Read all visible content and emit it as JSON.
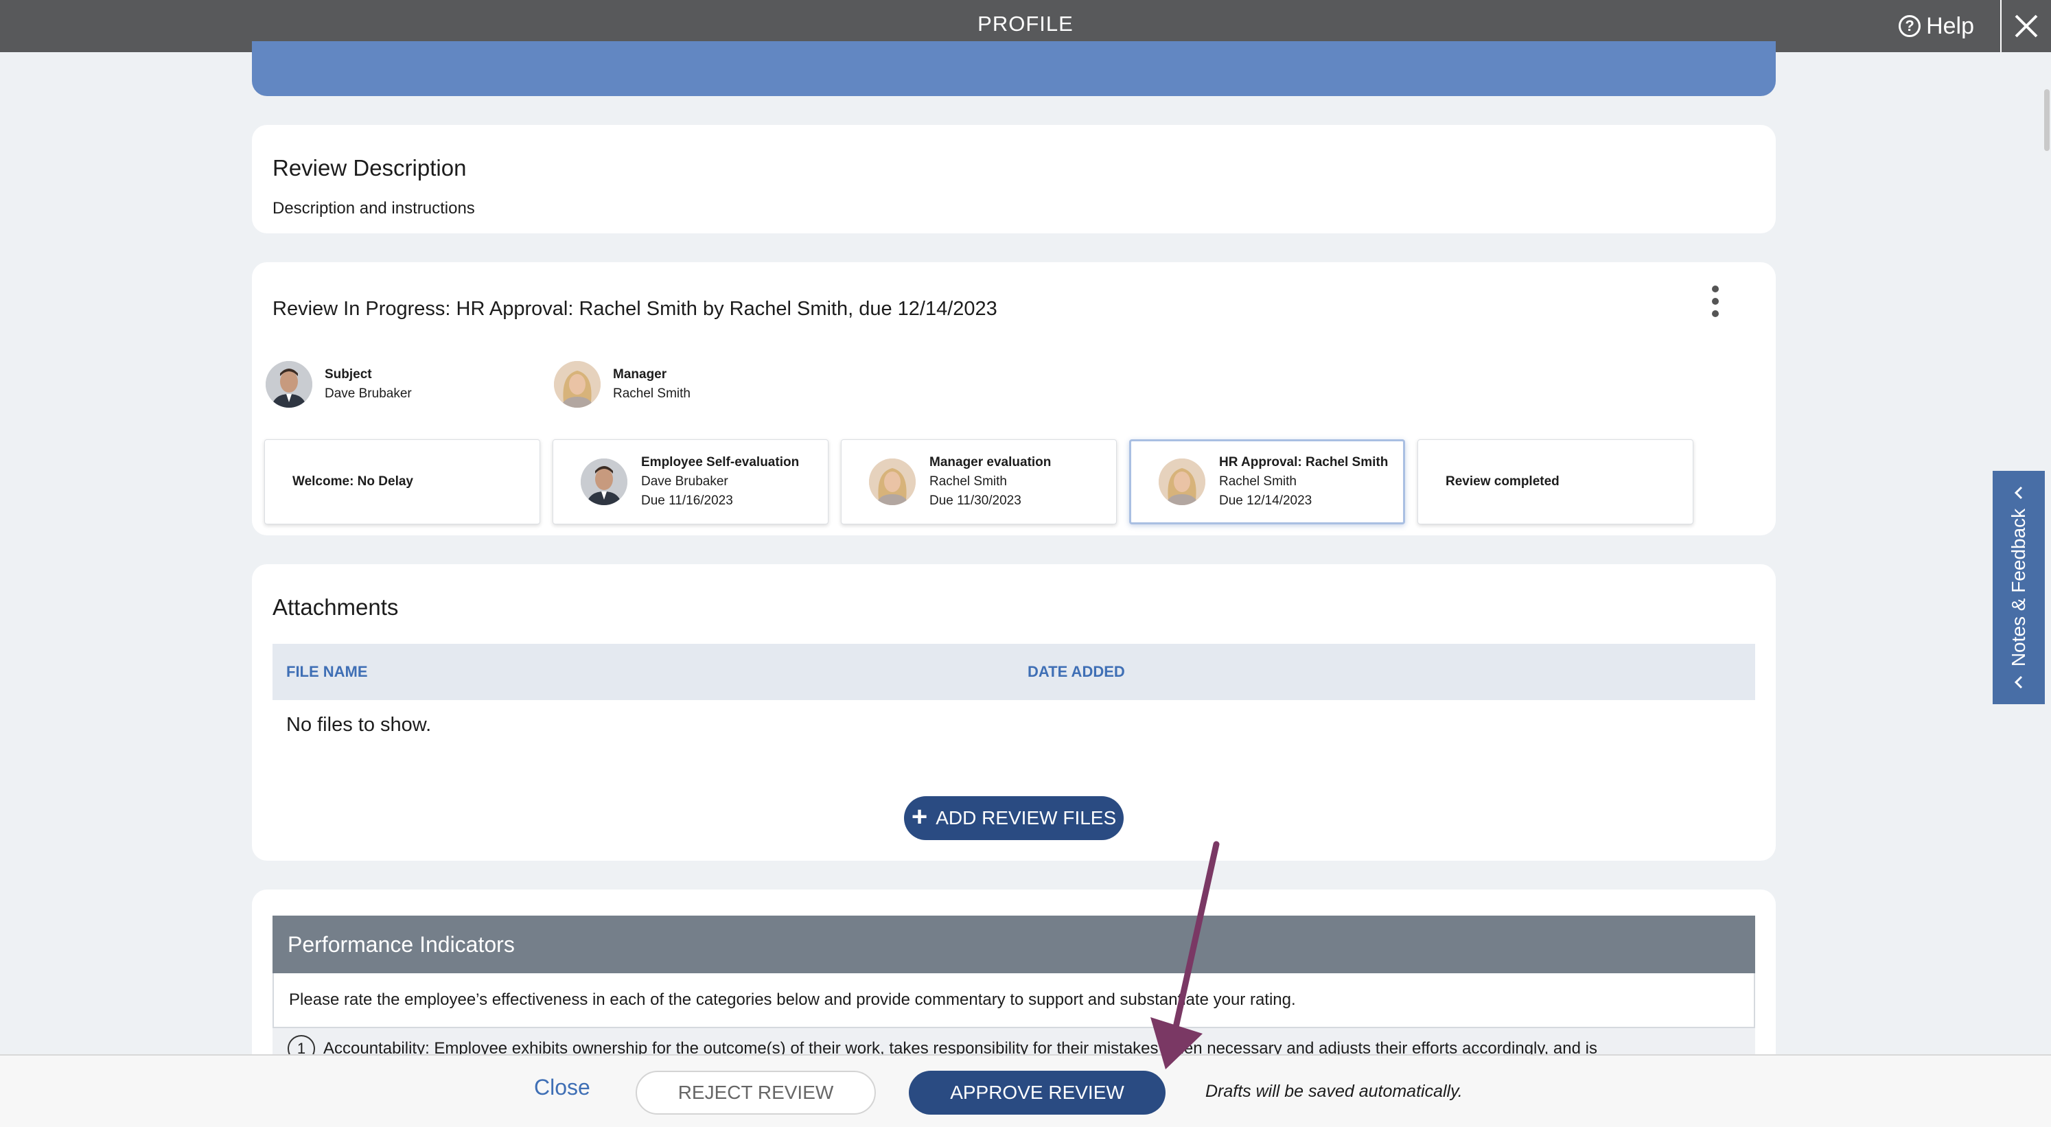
{
  "header": {
    "title": "PROFILE",
    "help_label": "Help",
    "help_icon": "help-circle-icon",
    "close_icon": "close-icon"
  },
  "review_description": {
    "title": "Review Description",
    "subtitle": "Description and instructions"
  },
  "review_progress": {
    "title": "Review In Progress: HR Approval: Rachel Smith by Rachel Smith, due 12/14/2023",
    "subject": {
      "role": "Subject",
      "name": "Dave Brubaker"
    },
    "manager": {
      "role": "Manager",
      "name": "Rachel Smith"
    },
    "steps": [
      {
        "label": "Welcome: No Delay"
      },
      {
        "label": "Employee Self-evaluation",
        "name": "Dave Brubaker",
        "due": "Due 11/16/2023"
      },
      {
        "label": "Manager evaluation",
        "name": "Rachel Smith",
        "due": "Due 11/30/2023"
      },
      {
        "label": "HR Approval: Rachel Smith",
        "name": "Rachel Smith",
        "due": "Due 12/14/2023"
      },
      {
        "label": "Review completed"
      }
    ]
  },
  "attachments": {
    "title": "Attachments",
    "columns": [
      "FILE NAME",
      "DATE ADDED"
    ],
    "empty_text": "No files to show.",
    "add_button": "ADD REVIEW FILES"
  },
  "performance": {
    "title": "Performance Indicators",
    "instructions": "Please rate the employee’s effectiveness in each of the categories below and provide commentary to support and substantiate your rating.",
    "item_number": "1",
    "item_text": "Accountability: Employee exhibits ownership for the outcome(s) of their work, takes responsibility for their mistakes when necessary and adjusts their efforts accordingly, and is"
  },
  "footer": {
    "close_label": "Close",
    "reject_label": "REJECT REVIEW",
    "approve_label": "APPROVE REVIEW",
    "autosave_text": "Drafts will be saved automatically."
  },
  "side_tab": {
    "label": "Notes & Feedback"
  },
  "colors": {
    "topbar": "#58595b",
    "primary_button": "#2a4b82",
    "link": "#3f6fb5",
    "annotation_arrow": "#7a3864"
  }
}
